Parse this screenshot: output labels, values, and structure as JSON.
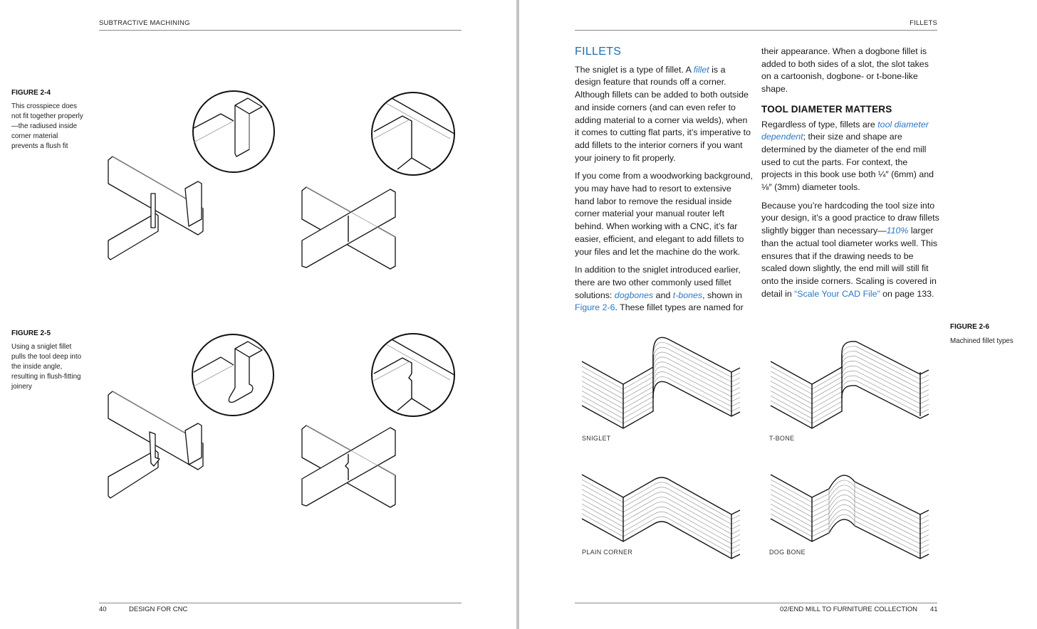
{
  "left_page": {
    "running_head": "SUBTRACTIVE MACHINING",
    "folio_number": "40",
    "folio_title": "DESIGN FOR CNC",
    "figures": [
      {
        "label": "FIGURE 2-4",
        "caption": "This crosspiece does not fit together properly—the radiused inside corner material prevents a flush fit"
      },
      {
        "label": "FIGURE 2-5",
        "caption": "Using a sniglet fillet pulls the tool deep into the inside angle, resulting in flush-fitting joinery"
      }
    ]
  },
  "right_page": {
    "running_head": "FILLETS",
    "folio_title": "02/END MILL TO FURNITURE COLLECTION",
    "folio_number": "41",
    "section_heading": "FILLETS",
    "col1": {
      "p1_a": "The sniglet is a type of fillet. A ",
      "p1_link": "fillet",
      "p1_b": " is a design feature that rounds off a corner. Although fillets can be added to both outside and inside corners (and can even refer to adding material to a corner via welds), when it comes to cutting flat parts, it’s imperative to add fillets to the interior corners if you want your joinery to fit properly.",
      "p2": "If you come from a woodworking background, you may have had to resort to extensive hand labor to remove the residual inside corner material your manual router left behind. When working with a CNC, it’s far easier, efficient, and elegant to add fillets to your files and let the machine do the work.",
      "p3_a": "In addition to the sniglet introduced earlier, there are two other commonly used fillet solutions: ",
      "p3_link1": "dogbones",
      "p3_b": " and ",
      "p3_link2": "t-bones",
      "p3_c": ", shown in ",
      "p3_link3": "Figure 2-6",
      "p3_d": ". These fillet types are named for"
    },
    "col2": {
      "p1": "their appearance. When a dogbone fillet is added to both sides of a slot, the slot takes on a cartoonish, dogbone- or t-bone-like shape.",
      "subheading": "TOOL DIAMETER MATTERS",
      "p2_a": "Regardless of type, fillets are ",
      "p2_link": "tool diameter dependent",
      "p2_b": "; their size and shape are determined by the diameter of the end mill used to cut the parts. For context, the projects in this book use both ¼″ (6mm) and ⅛″ (3mm) diameter tools.",
      "p3_a": "Because you’re hardcoding the tool size into your design, it’s a good practice to draw fillets slightly bigger than necessary—",
      "p3_link": "110%",
      "p3_b": " larger than the actual tool diameter works well. This ensures that if the drawing needs to be scaled down slightly, the end mill will still fit onto the inside corners. Scaling is covered in detail in ",
      "p3_link2": "“Scale Your CAD File”",
      "p3_c": " on page 133."
    },
    "figure": {
      "label": "FIGURE 2-6",
      "caption": "Machined fillet types",
      "panels": [
        "SNIGLET",
        "T-BONE",
        "PLAIN CORNER",
        "DOG BONE"
      ]
    }
  },
  "colors": {
    "heading_blue": "#1f6fb2",
    "link_blue": "#2b78c2"
  }
}
